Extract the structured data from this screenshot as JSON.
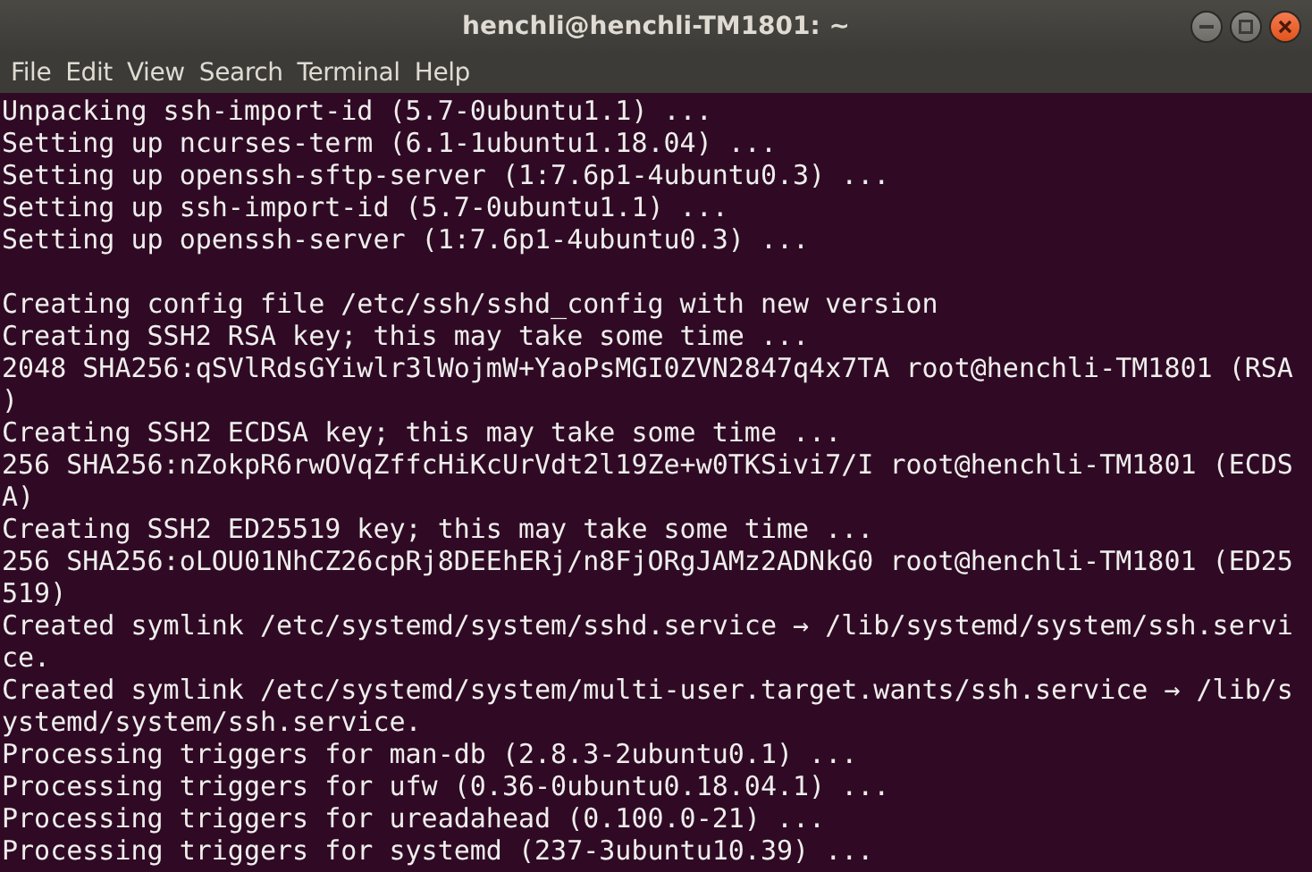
{
  "window": {
    "title": "henchli@henchli-TM1801: ~"
  },
  "menu": [
    "File",
    "Edit",
    "View",
    "Search",
    "Terminal",
    "Help"
  ],
  "terminal": {
    "blocks": [
      [
        "Unpacking ssh-import-id (5.7-0ubuntu1.1) ...",
        "Setting up ncurses-term (6.1-1ubuntu1.18.04) ...",
        "Setting up openssh-sftp-server (1:7.6p1-4ubuntu0.3) ...",
        "Setting up ssh-import-id (5.7-0ubuntu1.1) ...",
        "Setting up openssh-server (1:7.6p1-4ubuntu0.3) ..."
      ],
      [
        "Creating config file /etc/ssh/sshd_config with new version",
        "Creating SSH2 RSA key; this may take some time ...",
        "2048 SHA256:qSVlRdsGYiwlr3lWojmW+YaoPsMGI0ZVN2847q4x7TA root@henchli-TM1801 (RSA",
        ")",
        "Creating SSH2 ECDSA key; this may take some time ...",
        "256 SHA256:nZokpR6rwOVqZffcHiKcUrVdt2l19Ze+w0TKSivi7/I root@henchli-TM1801 (ECDS",
        "A)",
        "Creating SSH2 ED25519 key; this may take some time ...",
        "256 SHA256:oLOU01NhCZ26cpRj8DEEhERj/n8FjORgJAMz2ADNkG0 root@henchli-TM1801 (ED25",
        "519)",
        "Created symlink /etc/systemd/system/sshd.service → /lib/systemd/system/ssh.servi",
        "ce.",
        "Created symlink /etc/systemd/system/multi-user.target.wants/ssh.service → /lib/s",
        "ystemd/system/ssh.service.",
        "Processing triggers for man-db (2.8.3-2ubuntu0.1) ...",
        "Processing triggers for ufw (0.36-0ubuntu0.18.04.1) ...",
        "Processing triggers for ureadahead (0.100.0-21) ...",
        "Processing triggers for systemd (237-3ubuntu10.39) ..."
      ]
    ]
  }
}
